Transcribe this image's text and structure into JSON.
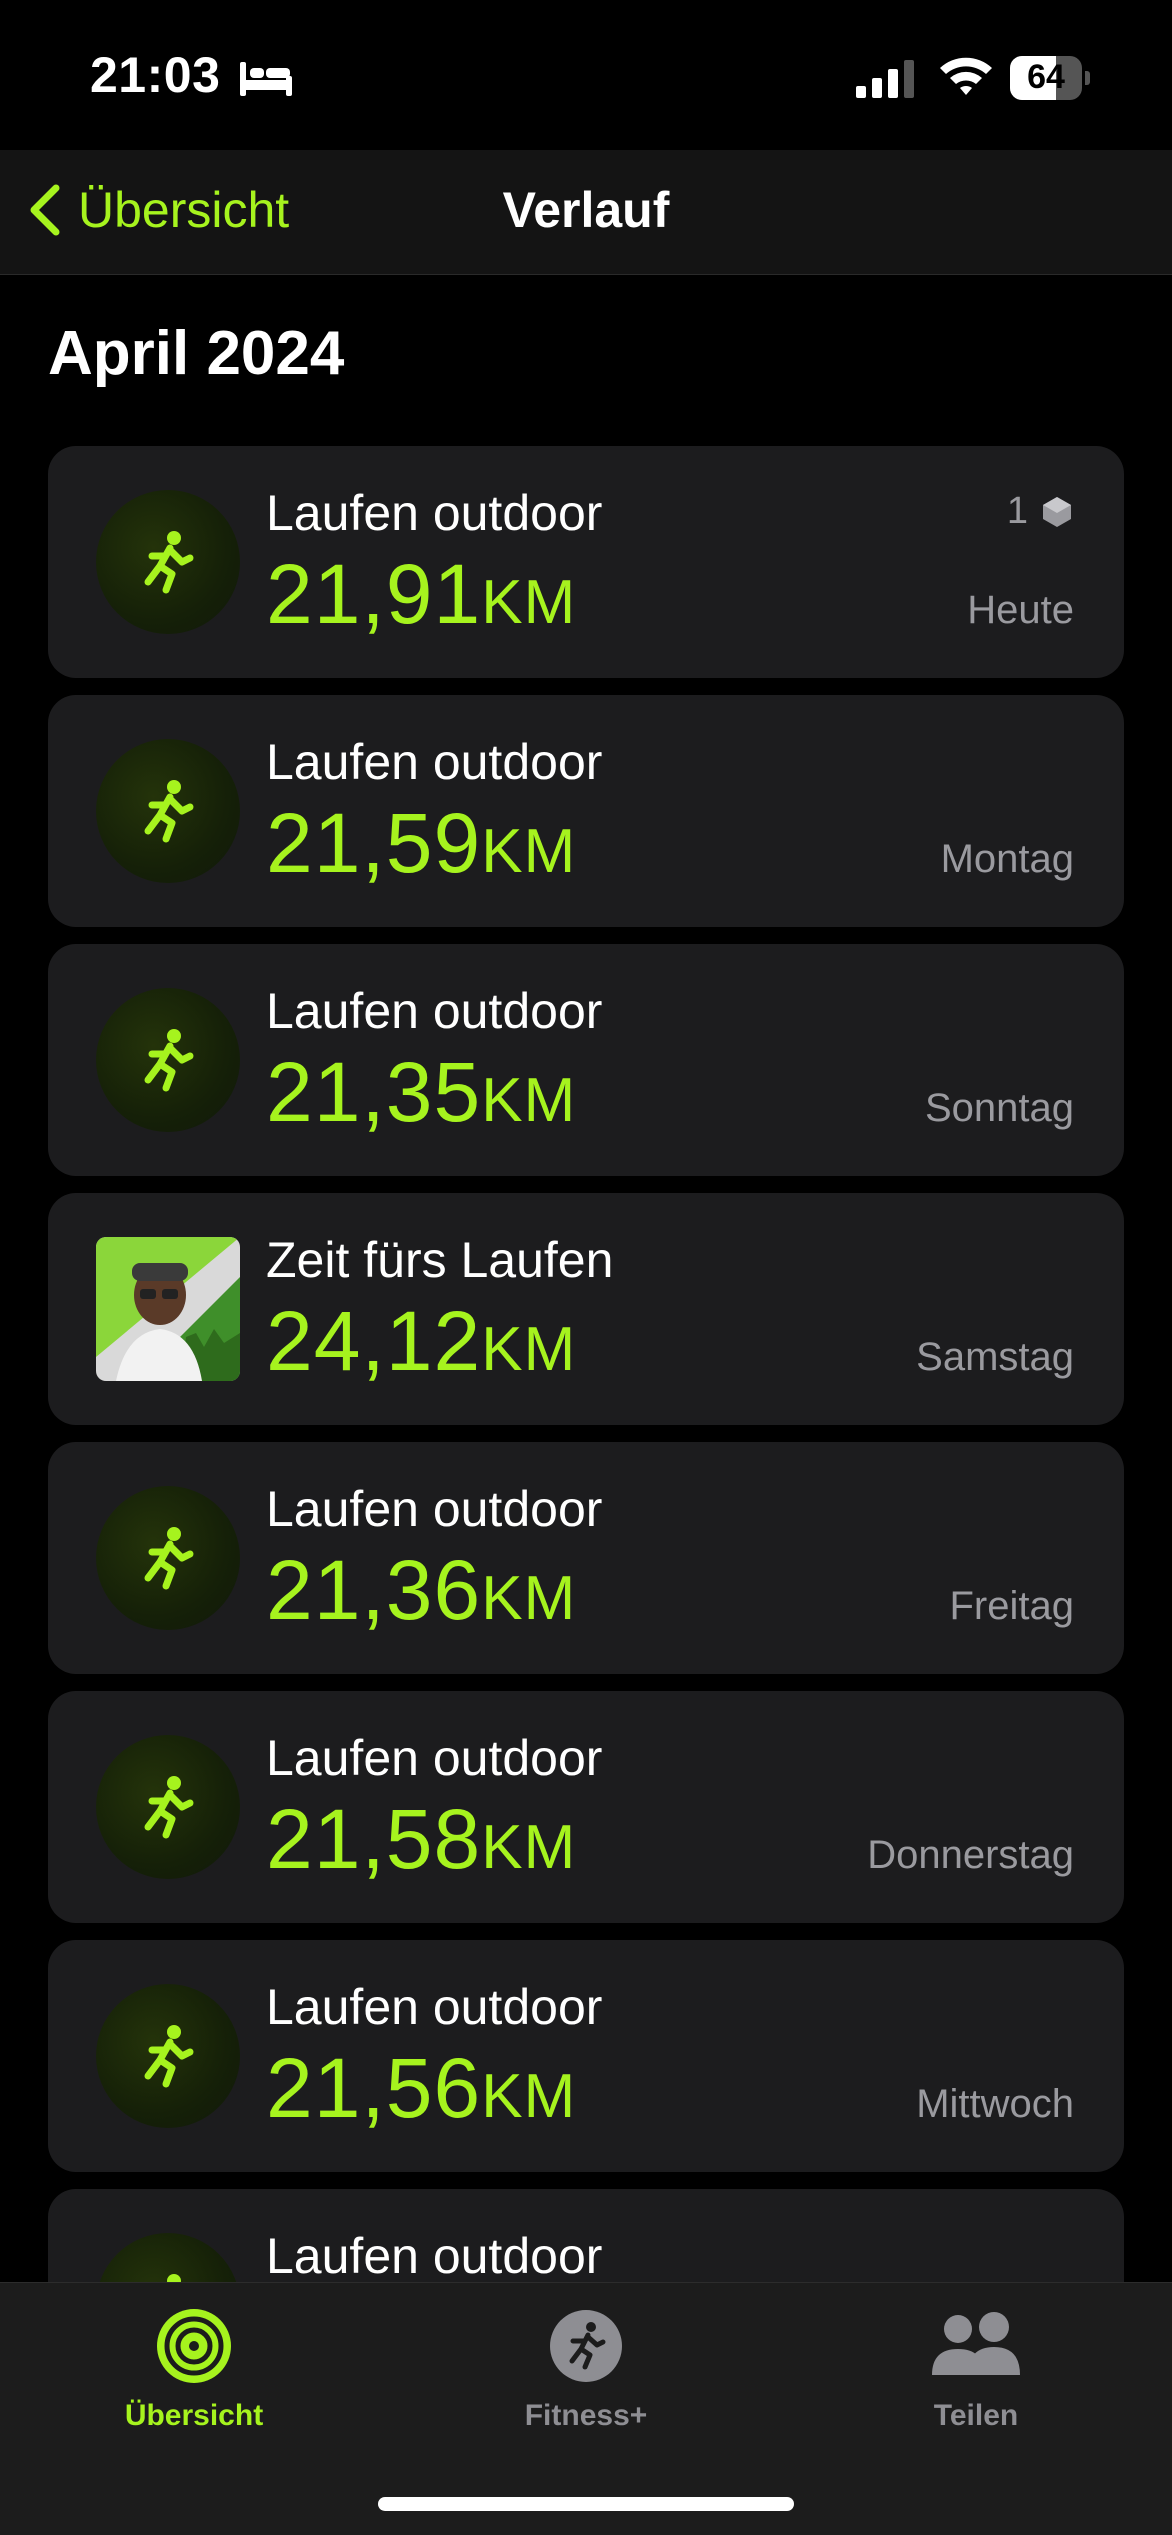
{
  "status_bar": {
    "time": "21:03",
    "battery_percent": "64",
    "battery_level": 0.64
  },
  "nav": {
    "back_label": "Übersicht",
    "title": "Verlauf"
  },
  "section": {
    "title": "April 2024"
  },
  "workouts": [
    {
      "title": "Laufen outdoor",
      "distance": "21,91",
      "unit": "KM",
      "day": "Heute",
      "badge_count": "1",
      "type": "run"
    },
    {
      "title": "Laufen outdoor",
      "distance": "21,59",
      "unit": "KM",
      "day": "Montag",
      "type": "run"
    },
    {
      "title": "Laufen outdoor",
      "distance": "21,35",
      "unit": "KM",
      "day": "Sonntag",
      "type": "run"
    },
    {
      "title": "Zeit fürs Laufen",
      "distance": "24,12",
      "unit": "KM",
      "day": "Samstag",
      "type": "program"
    },
    {
      "title": "Laufen outdoor",
      "distance": "21,36",
      "unit": "KM",
      "day": "Freitag",
      "type": "run"
    },
    {
      "title": "Laufen outdoor",
      "distance": "21,58",
      "unit": "KM",
      "day": "Donnerstag",
      "type": "run"
    },
    {
      "title": "Laufen outdoor",
      "distance": "21,56",
      "unit": "KM",
      "day": "Mittwoch",
      "type": "run"
    },
    {
      "title": "Laufen outdoor",
      "type": "run"
    }
  ],
  "tabs": [
    {
      "label": "Übersicht",
      "icon": "activity-rings-icon",
      "active": true
    },
    {
      "label": "Fitness+",
      "icon": "fitness-plus-icon",
      "active": false
    },
    {
      "label": "Teilen",
      "icon": "people-icon",
      "active": false
    }
  ],
  "colors": {
    "accent": "#a6f31e",
    "card": "#1c1c1e",
    "secondary_text": "#9a9a9f"
  }
}
